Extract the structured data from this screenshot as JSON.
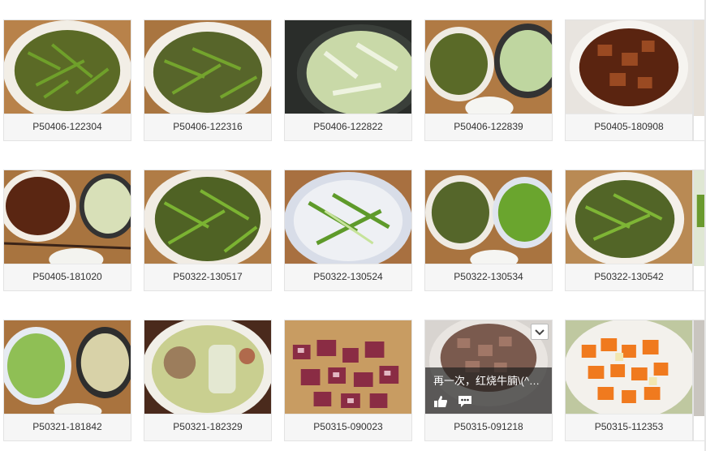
{
  "photos": [
    {
      "label": "P50406-122304",
      "dish": "celery"
    },
    {
      "label": "P50406-122316",
      "dish": "celery"
    },
    {
      "label": "P50406-122822",
      "dish": "soup-cabbage"
    },
    {
      "label": "P50406-122839",
      "dish": "celery-and-soup"
    },
    {
      "label": "P50405-180908",
      "dish": "braised-meat"
    },
    {
      "label": "P50405-181020",
      "dish": "braised-and-soup"
    },
    {
      "label": "P50322-130517",
      "dish": "celery"
    },
    {
      "label": "P50322-130524",
      "dish": "celery-blue-plate"
    },
    {
      "label": "P50322-130534",
      "dish": "two-plates"
    },
    {
      "label": "P50322-130542",
      "dish": "celery"
    },
    {
      "label": "P50321-181842",
      "dish": "greens-and-soup"
    },
    {
      "label": "P50321-182329",
      "dish": "meatball-soup"
    },
    {
      "label": "P50315-090023",
      "dish": "diced-meat-board"
    },
    {
      "label": "P50315-091218",
      "dish": "beef-bowl"
    },
    {
      "label": "P50315-112353",
      "dish": "diced-carrot"
    }
  ],
  "hover_overlay": {
    "photo_label": "P50315-091218",
    "title": "再一次，红烧牛腩\\(^…",
    "like_icon": "thumbs-up-icon",
    "comment_icon": "comment-icon",
    "menu_icon": "chevron-down-icon"
  },
  "colors": {
    "caption_bg": "#f6f6f6",
    "caption_text": "#333333",
    "tile_border": "#e3e3e3",
    "overlay_bg": "#1e1e1e"
  }
}
